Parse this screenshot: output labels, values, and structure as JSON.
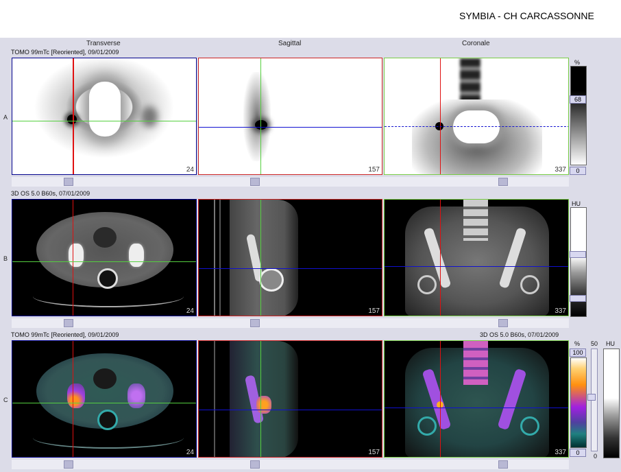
{
  "site_title": "SYMBIA - CH CARCASSONNE",
  "view_headers": [
    "Transverse",
    "Sagittal",
    "Coronale"
  ],
  "rows": {
    "a": {
      "label": "A",
      "info": "TOMO 99mTc [Reoriented], 09/01/2009"
    },
    "b": {
      "label": "B",
      "info": "3D  OS  5.0  B60s, 07/01/2009"
    },
    "c": {
      "label": "C",
      "info_left": "TOMO 99mTc [Reoriented], 09/01/2009",
      "info_right": "3D  OS  5.0  B60s, 07/01/2009"
    }
  },
  "slice_numbers": {
    "transverse": "24",
    "sagittal": "157",
    "coronal": "337"
  },
  "scales": {
    "a": {
      "unit": "%",
      "max": "68",
      "min": "0"
    },
    "b": {
      "unit": "HU"
    },
    "c": {
      "unit_pct": "%",
      "max": "100",
      "min": "0",
      "mid": "50",
      "unit_hu": "HU",
      "hu_min": "0"
    }
  },
  "colors": {
    "transverse_frame": "#00008b",
    "sagittal_frame": "#cc2222",
    "coronal_frame": "#77cc44",
    "crosshair_red": "#e01010",
    "crosshair_green": "#55d040",
    "crosshair_blue": "#1010d0"
  },
  "icons": [
    "slider-thumb-icon"
  ]
}
